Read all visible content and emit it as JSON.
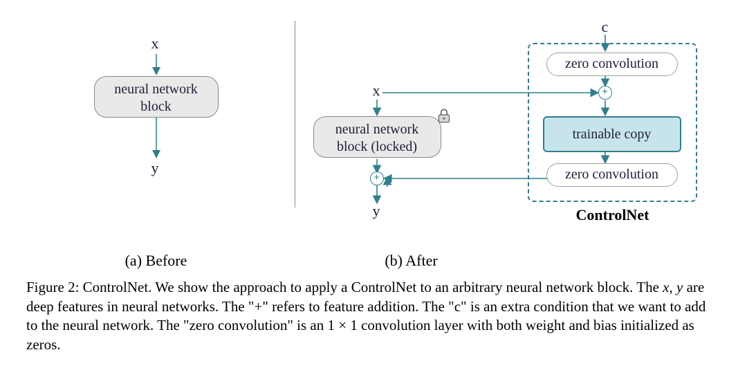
{
  "panel_a": {
    "x": "x",
    "y": "y",
    "block": "neural network\nblock",
    "caption": "(a) Before"
  },
  "panel_b": {
    "x": "x",
    "y": "y",
    "c": "c",
    "block_locked": "neural network\nblock (locked)",
    "zero_conv": "zero convolution",
    "trainable_copy": "trainable copy",
    "controlnet_label": "ControlNet",
    "caption": "(b) After"
  },
  "plus": "+",
  "caption": {
    "fig_label": "Figure 2: ControlNet.",
    "s1": "We show the approach to apply a ControlNet to an arbitrary neural network block. The ",
    "xy": "x, y",
    "s2": " are deep features in neural networks. The \"+\" refers to feature addition. The \"c\" is an extra condition that we want to add to the neural network. The \"zero convolution\" is an ",
    "onebyone": "1 × 1",
    "s3": " convolution layer with both weight and bias initialized as zeros."
  }
}
